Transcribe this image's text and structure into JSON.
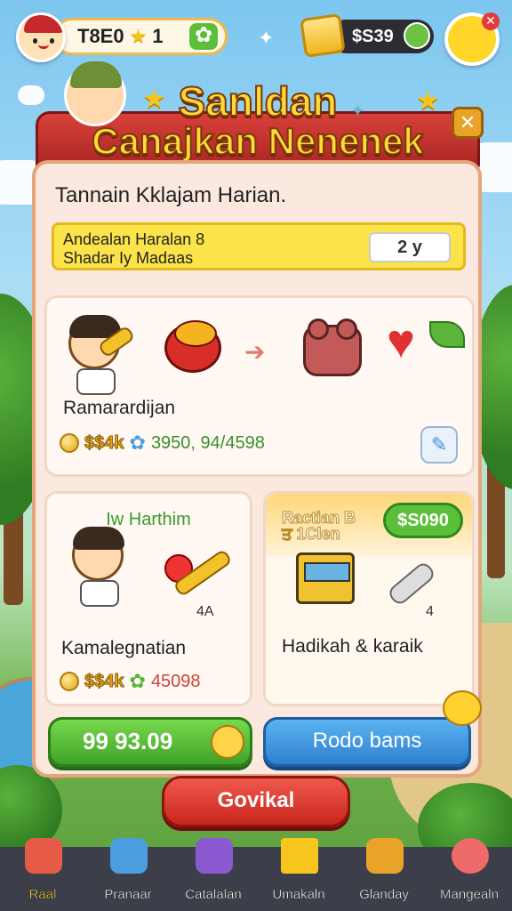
{
  "topbar": {
    "level": "T8E0",
    "level_star": "★",
    "level_num": "1",
    "coins": "$S39",
    "notification_badge": "✕"
  },
  "game": {
    "title_line1": "Sanldan",
    "title_line2": "Canajkan Nenenek"
  },
  "panel": {
    "subtitle": "Tannain Kklajam Harian.",
    "quest": {
      "line1": "Andealan Haralan 8",
      "line2": "Shadar  Iy Madaas",
      "count": "2 y"
    },
    "main_card": {
      "name": "Ramarardijan",
      "reward_gold": "$$4k",
      "reward_gem": "3950, 94/4598"
    },
    "left_card": {
      "title": "Iw Harthim",
      "badge": "4A",
      "name": "Kamalegnatian",
      "reward_gold": "$$4k",
      "reward_other": "45098"
    },
    "right_card": {
      "title_line1": "Ractian B",
      "title_line2": "ਤ 1Clen",
      "price": "$S090",
      "badge": "4",
      "name": "Hadikah & karaik"
    },
    "btn_green": "99 93.09",
    "btn_blue": "Rodo bams"
  },
  "btn_red": "Govikal",
  "nav": [
    {
      "label": "Raal",
      "active": true
    },
    {
      "label": "Pranaar",
      "active": false
    },
    {
      "label": "Catalalan",
      "active": false
    },
    {
      "label": "Umakaln",
      "active": false
    },
    {
      "label": "Glanday",
      "active": false
    },
    {
      "label": "Mangealn",
      "active": false
    }
  ],
  "colors": {
    "panel_bg": "#fbe8df",
    "title_ribbon": "#c9312c",
    "quest_bar": "#fbe34a",
    "btn_green": "#4cb532",
    "btn_blue": "#3a8fe0",
    "btn_red": "#e03a2f",
    "nav_bg": "#3c3f4a"
  }
}
